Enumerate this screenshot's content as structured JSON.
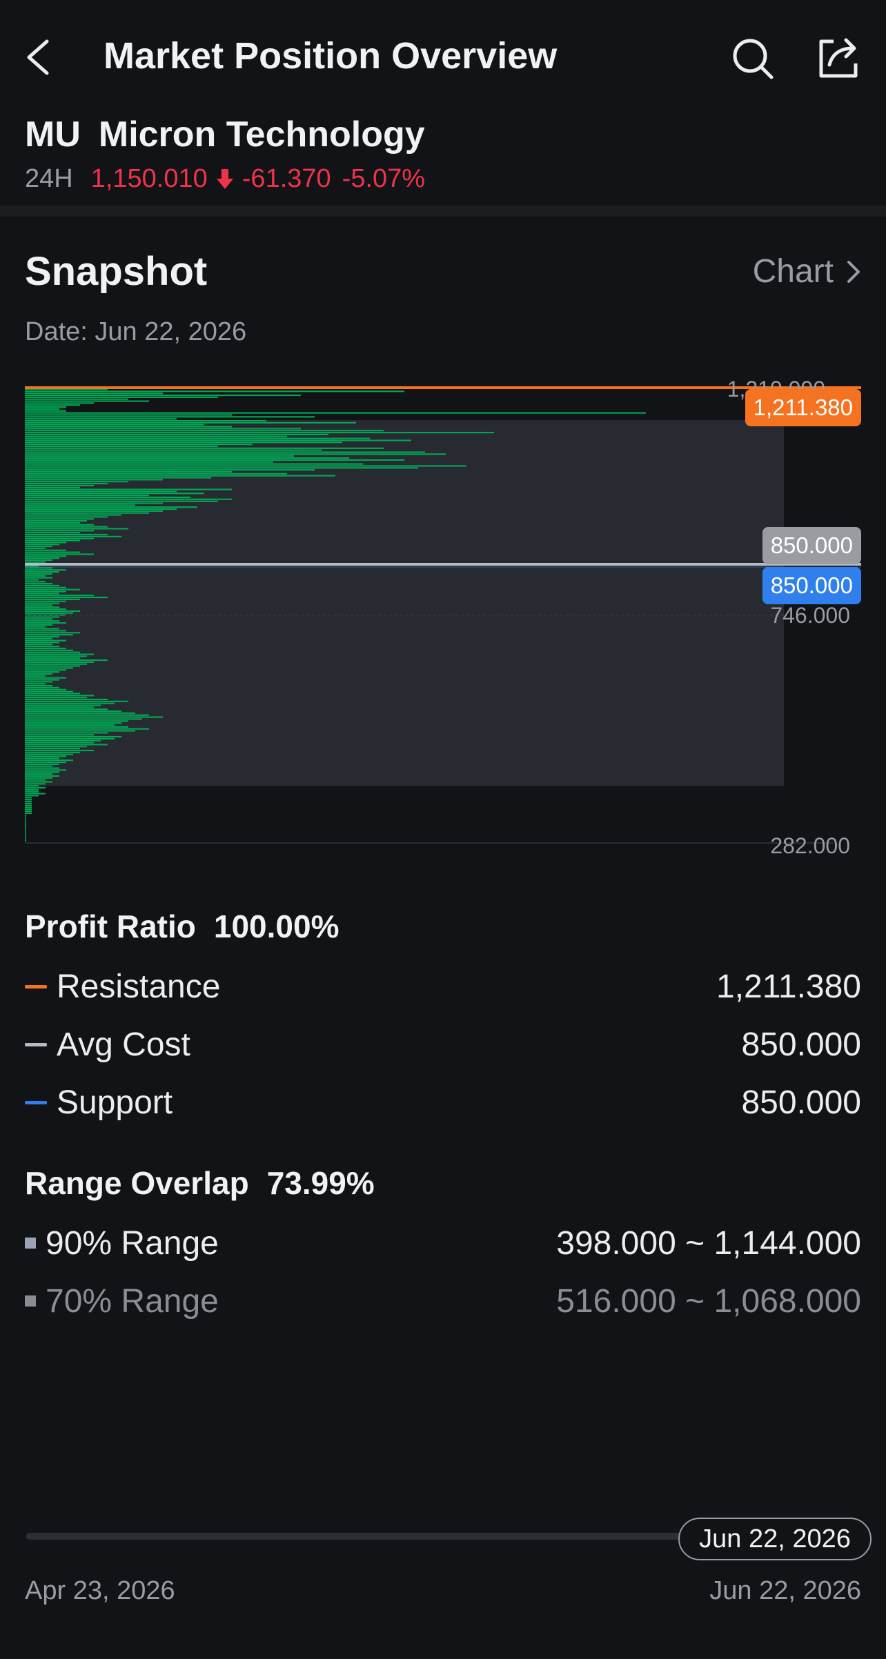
{
  "header": {
    "title": "Market Position Overview",
    "icons": {
      "back": "chevron-left-icon",
      "search": "search-icon",
      "share": "share-icon"
    }
  },
  "stock": {
    "symbol": "MU",
    "name": "Micron Technology",
    "period_label": "24H",
    "price": "1,150.010",
    "change": "-61.370",
    "change_pct": "-5.07%",
    "direction_icon": "arrow-down-icon"
  },
  "snapshot": {
    "title": "Snapshot",
    "chart_link": "Chart",
    "date_text": "Date: Jun 22, 2026"
  },
  "chart_tags": {
    "resistance": "1,211.380",
    "avg_cost": "850.000",
    "support": "850.000"
  },
  "chart_axis": {
    "top": "1,210.000",
    "mid": "746.000",
    "bottom": "282.000"
  },
  "chart_data": {
    "type": "bar",
    "orientation": "horizontal",
    "y_range": [
      282,
      1210
    ],
    "price_levels": [
      1206,
      1202,
      1198,
      1194,
      1190,
      1186,
      1182,
      1178,
      1174,
      1170,
      1166,
      1162,
      1158,
      1154,
      1150,
      1146,
      1142,
      1138,
      1134,
      1130,
      1126,
      1122,
      1118,
      1114,
      1110,
      1106,
      1102,
      1098,
      1094,
      1090,
      1086,
      1082,
      1078,
      1074,
      1070,
      1066,
      1062,
      1058,
      1054,
      1050,
      1046,
      1042,
      1038,
      1034,
      1030,
      1026,
      1022,
      1018,
      1014,
      1010,
      1006,
      1002,
      998,
      994,
      990,
      986,
      982,
      978,
      974,
      970,
      966,
      962,
      958,
      954,
      950,
      946,
      942,
      938,
      934,
      930,
      926,
      922,
      918,
      914,
      910,
      906,
      902,
      898,
      894,
      890,
      886,
      882,
      878,
      874,
      870,
      866,
      862,
      858,
      854,
      850,
      846,
      842,
      838,
      834,
      830,
      826,
      822,
      818,
      814,
      810,
      806,
      802,
      798,
      794,
      790,
      786,
      782,
      778,
      774,
      770,
      766,
      762,
      758,
      754,
      750,
      746,
      742,
      738,
      734,
      730,
      726,
      722,
      718,
      714,
      710,
      706,
      702,
      698,
      694,
      690,
      686,
      682,
      678,
      674,
      670,
      666,
      662,
      658,
      654,
      650,
      646,
      642,
      638,
      634,
      630,
      626,
      622,
      618,
      614,
      610,
      606,
      602,
      598,
      594,
      590,
      586,
      582,
      578,
      574,
      570,
      566,
      562,
      558,
      554,
      550,
      546,
      542,
      538,
      534,
      530,
      526,
      522,
      518,
      514,
      510,
      506,
      502,
      498,
      494,
      490,
      486,
      482,
      478,
      474,
      470,
      466,
      462,
      458,
      454,
      450,
      446,
      442,
      438,
      434,
      430,
      426,
      422,
      418,
      414,
      410,
      406,
      402,
      398,
      394,
      390,
      386,
      382,
      378,
      374,
      370,
      366,
      362,
      358,
      354,
      350,
      346,
      342,
      338,
      334,
      330,
      326,
      322,
      318,
      314,
      310,
      306,
      302,
      298,
      294,
      290,
      286
    ],
    "volumes": [
      0.12,
      0.55,
      0.2,
      0.4,
      0.28,
      0.15,
      0.18,
      0.1,
      0.08,
      0.06,
      0.05,
      0.06,
      0.9,
      0.3,
      0.42,
      0.22,
      0.35,
      0.48,
      0.26,
      0.3,
      0.4,
      0.52,
      0.68,
      0.44,
      0.38,
      0.5,
      0.56,
      0.46,
      0.33,
      0.28,
      0.52,
      0.43,
      0.58,
      0.61,
      0.39,
      0.47,
      0.55,
      0.36,
      0.49,
      0.64,
      0.57,
      0.42,
      0.3,
      0.38,
      0.45,
      0.27,
      0.2,
      0.15,
      0.12,
      0.1,
      0.08,
      0.3,
      0.22,
      0.26,
      0.18,
      0.24,
      0.3,
      0.28,
      0.2,
      0.16,
      0.25,
      0.22,
      0.2,
      0.18,
      0.14,
      0.12,
      0.1,
      0.09,
      0.08,
      0.1,
      0.12,
      0.15,
      0.1,
      0.08,
      0.12,
      0.14,
      0.1,
      0.08,
      0.06,
      0.05,
      0.04,
      0.03,
      0.06,
      0.08,
      0.1,
      0.06,
      0.05,
      0.04,
      0.03,
      0.02,
      0.02,
      0.04,
      0.06,
      0.05,
      0.04,
      0.03,
      0.04,
      0.02,
      0.03,
      0.04,
      0.05,
      0.06,
      0.08,
      0.06,
      0.05,
      0.1,
      0.12,
      0.08,
      0.06,
      0.05,
      0.04,
      0.05,
      0.06,
      0.08,
      0.07,
      0.06,
      0.05,
      0.04,
      0.05,
      0.06,
      0.04,
      0.03,
      0.05,
      0.06,
      0.08,
      0.07,
      0.05,
      0.04,
      0.06,
      0.05,
      0.04,
      0.05,
      0.06,
      0.07,
      0.08,
      0.1,
      0.09,
      0.08,
      0.12,
      0.1,
      0.09,
      0.08,
      0.07,
      0.06,
      0.05,
      0.04,
      0.03,
      0.06,
      0.05,
      0.04,
      0.03,
      0.04,
      0.05,
      0.06,
      0.07,
      0.08,
      0.1,
      0.09,
      0.12,
      0.15,
      0.13,
      0.11,
      0.1,
      0.12,
      0.14,
      0.16,
      0.18,
      0.2,
      0.17,
      0.15,
      0.14,
      0.13,
      0.15,
      0.18,
      0.16,
      0.12,
      0.1,
      0.14,
      0.13,
      0.11,
      0.1,
      0.12,
      0.09,
      0.08,
      0.1,
      0.08,
      0.07,
      0.06,
      0.05,
      0.07,
      0.06,
      0.05,
      0.04,
      0.05,
      0.06,
      0.05,
      0.04,
      0.05,
      0.04,
      0.03,
      0.04,
      0.03,
      0.02,
      0.03,
      0.02,
      0.02,
      0.03,
      0.02,
      0.01,
      0.01,
      0.01,
      0.01,
      0.01,
      0.01,
      0.01,
      0.01,
      0.01
    ],
    "resistance": 1211.38,
    "avg_cost": 850.0,
    "support": 850.0,
    "range_band": [
      398,
      1144
    ],
    "colors": {
      "bars": "#00A854",
      "resistance": "#F57220",
      "avg_cost": "#B8BBC0",
      "support": "#2F80ED",
      "band": "#272B31"
    }
  },
  "profit": {
    "label": "Profit Ratio",
    "value": "100.00%"
  },
  "levels": [
    {
      "label": "Resistance",
      "value": "1,211.380",
      "color": "#F57220"
    },
    {
      "label": "Avg Cost",
      "value": "850.000",
      "color": "#B8BBC0"
    },
    {
      "label": "Support",
      "value": "850.000",
      "color": "#2F80ED"
    }
  ],
  "overlap": {
    "label": "Range Overlap",
    "value": "73.99%"
  },
  "ranges": [
    {
      "label": "90% Range",
      "value": "398.000 ~ 1,144.000",
      "color": "#9BA3B4"
    },
    {
      "label": "70% Range",
      "value": "516.000 ~ 1,068.000",
      "color": "#8B8D93"
    }
  ],
  "timeline": {
    "selected": "Jun 22, 2026",
    "start": "Apr 23, 2026",
    "end": "Jun 22, 2026"
  },
  "colors": {
    "background": "#121316",
    "down": "#F0334A"
  }
}
